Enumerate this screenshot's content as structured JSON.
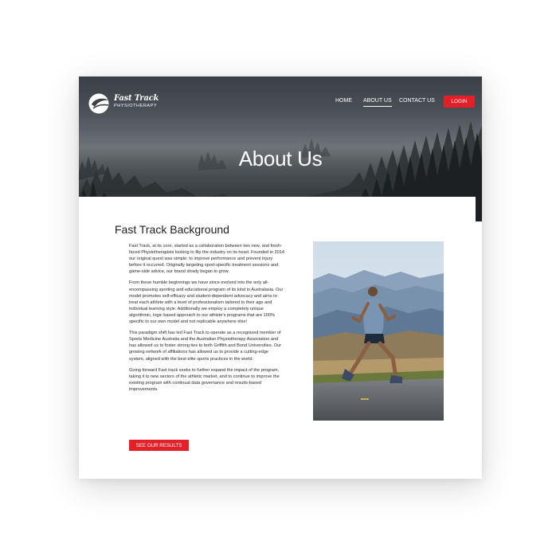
{
  "brand": {
    "title": "Fast Track",
    "subtitle": "PHYSIOTHERAPY"
  },
  "nav": {
    "items": [
      {
        "label": "HOME"
      },
      {
        "label": "ABOUT US"
      },
      {
        "label": "CONTACT US"
      }
    ],
    "login_label": "LOGIN"
  },
  "hero": {
    "title": "About Us"
  },
  "section": {
    "title": "Fast Track Background",
    "paragraphs": [
      "Fast Track, at its core, started as a collaboration between two new, and fresh-faced Physiotherapists looking to flip the industry on its head. Founded in 2014 our original quest was simple; to improve performance and prevent injury before it occurred. Originally targeting sport-specific treatment sessions and game-side advice, our brand slowly began to grow.",
      "From these humble beginnings we have since evolved into the only all-encompassing sporting and educational program of its kind in Australasia. Our model promotes self-efficacy and student-dependent advocacy and aims to treat each athlete with a level of professionalism tailored to their age and individual learning style. Additionally we employ a completely unique algorithmic, logic based approach to our athlete's programs that are 100% specific to our own model and not replicable anywhere else!",
      "This paradigm shift has led Fast Track to operate as a recognized member of Sports Medicine Australia and the Australian Physiotherapy Association and has allowed us to foster strong ties to both Griffith and Bond Universities. Our growing network of affiliations has allowed us to provide a cutting-edge system, aligned with the best elite sports practices in the world.",
      "Going forward Fast track seeks to further expand the impact of the program, taking it to new sectors of the athletic market, and to continue to improve the existing program with continual data governance and results-based improvements."
    ],
    "cta_label": "SEE OUR RESULTS"
  },
  "colors": {
    "accent": "#e32028",
    "text": "#2a2a2a",
    "hero_overlay": "#3a4046"
  }
}
